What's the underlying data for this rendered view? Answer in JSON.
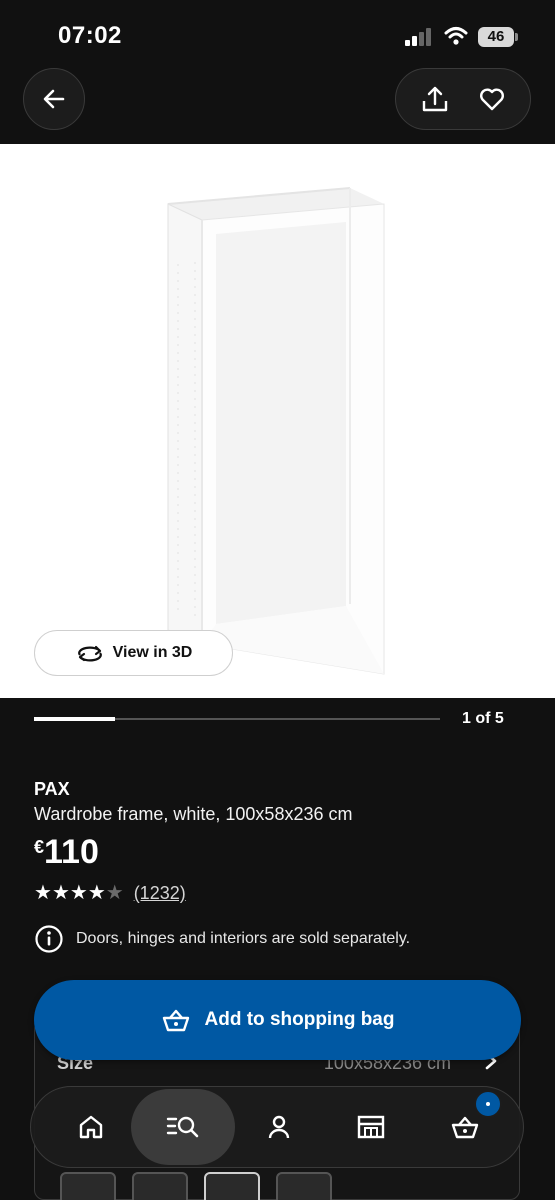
{
  "status_bar": {
    "time": "07:02",
    "battery": "46"
  },
  "nav": {
    "back_icon": "arrow-left-icon",
    "share_icon": "share-icon",
    "favorite_icon": "heart-icon"
  },
  "gallery": {
    "view_3d_label": "View in 3D",
    "pager_text": "1 of 5",
    "pager_progress": 0.2
  },
  "product": {
    "brand": "PAX",
    "description": "Wardrobe frame, white, 100x58x236 cm",
    "price_currency": "€",
    "price_value": "110",
    "rating": 4,
    "rating_max": 5,
    "review_count": "(1232)",
    "notice": "Doors, hinges and interiors are sold separately."
  },
  "size": {
    "label": "Size",
    "value": "100x58x236 cm"
  },
  "add_to_bag": {
    "label": "Add to shopping bag"
  },
  "tab_bar": {
    "items": [
      {
        "icon": "home-icon",
        "active": false
      },
      {
        "icon": "search-list-icon",
        "active": true
      },
      {
        "icon": "profile-icon",
        "active": false
      },
      {
        "icon": "store-icon",
        "active": false
      },
      {
        "icon": "shopping-bag-icon",
        "active": false
      }
    ]
  },
  "colors": {
    "background": "#111111",
    "accent": "#0058a3",
    "image_bg": "#ffffff"
  }
}
